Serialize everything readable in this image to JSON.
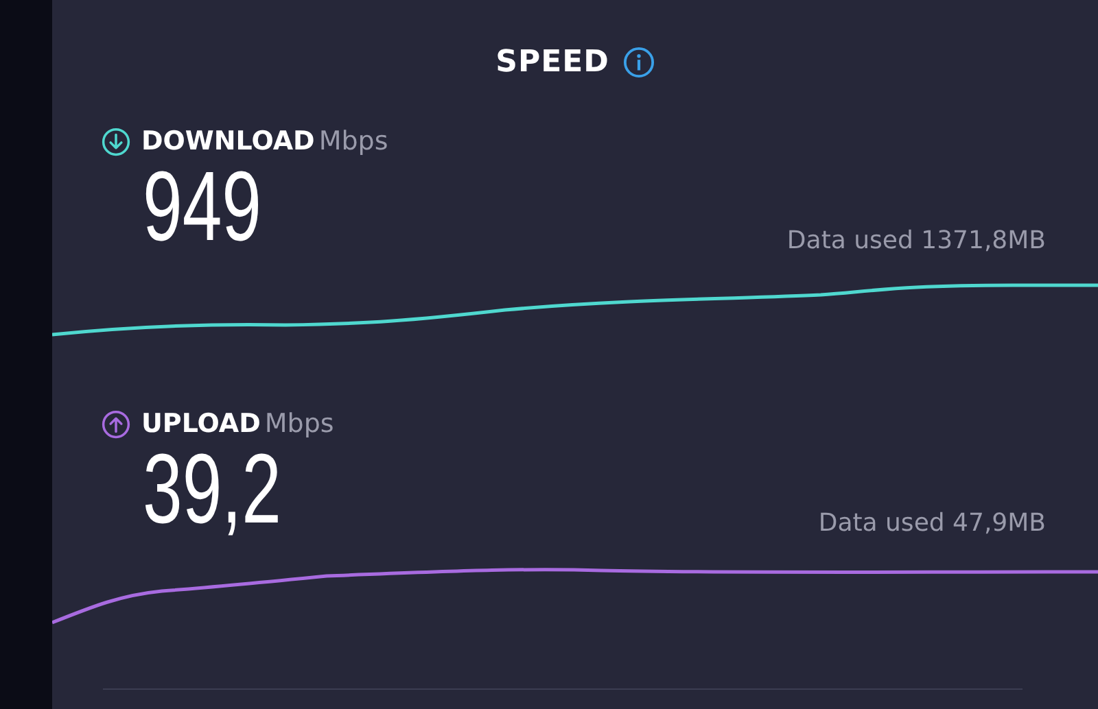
{
  "title": "SPEED",
  "metrics": [
    {
      "kind": "download",
      "label": "DOWNLOAD",
      "unit": "Mbps",
      "value": "949",
      "data_used": "Data used 1371,8MB",
      "color": "#4fd8cf"
    },
    {
      "kind": "upload",
      "label": "UPLOAD",
      "unit": "Mbps",
      "value": "39,2",
      "data_used": "Data used 47,9MB",
      "color": "#a86be0"
    }
  ]
}
